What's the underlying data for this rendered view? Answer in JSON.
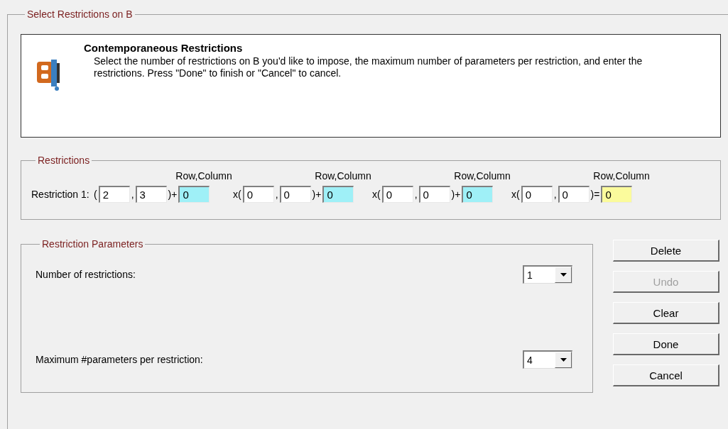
{
  "title": "Select Restrictions on B",
  "header": {
    "heading": "Contemporaneous Restrictions",
    "text": "Select the number of restrictions on B you'd like to impose, the maximum number of parameters per restriction, and enter the restrictions. Press \"Done\" to finish or \"Cancel\" to cancel."
  },
  "restrictions": {
    "title": "Restrictions",
    "rows": [
      {
        "label": "Restriction 1:",
        "terms": [
          {
            "header": "Row,Column",
            "open": "(",
            "row": "2",
            "sep": ",",
            "column": "3",
            "close": ")+",
            "value": "0",
            "kind": "coefficient"
          },
          {
            "header": "Row,Column",
            "open": "x(",
            "row": "0",
            "sep": ",",
            "column": "0",
            "close": ")+",
            "value": "0",
            "kind": "coefficient"
          },
          {
            "header": "Row,Column",
            "open": "x(",
            "row": "0",
            "sep": ",",
            "column": "0",
            "close": ")+",
            "value": "0",
            "kind": "coefficient"
          },
          {
            "header": "Row,Column",
            "open": "x(",
            "row": "0",
            "sep": ",",
            "column": "0",
            "close": ")=",
            "value": "0",
            "kind": "rhs"
          }
        ]
      }
    ]
  },
  "parameters": {
    "title": "Restriction Parameters",
    "fields": [
      {
        "label": "Number of restrictions:",
        "value": "1"
      },
      {
        "label": "Maximum #parameters per restriction:",
        "value": "4"
      }
    ]
  },
  "buttons": [
    {
      "label": "Delete",
      "disabled": false
    },
    {
      "label": "Undo",
      "disabled": true
    },
    {
      "label": "Clear",
      "disabled": false
    },
    {
      "label": "Done",
      "disabled": false
    },
    {
      "label": "Cancel",
      "disabled": false
    }
  ]
}
